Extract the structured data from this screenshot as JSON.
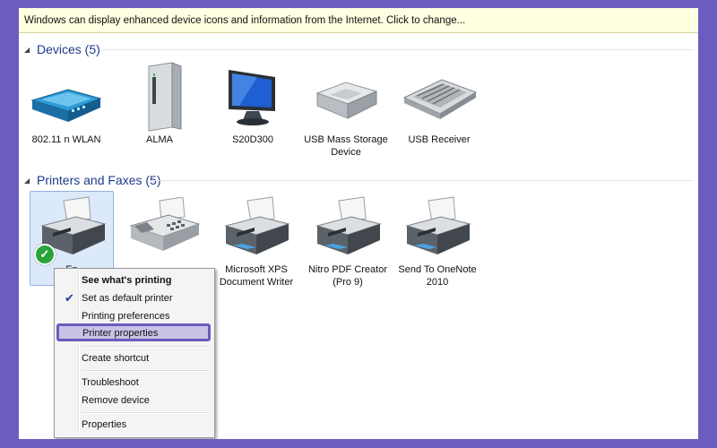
{
  "infobar": {
    "text": "Windows can display enhanced device icons and information from the Internet. Click to change..."
  },
  "devices_group": {
    "title": "Devices (5)"
  },
  "devices": [
    {
      "label": "802.11 n WLAN",
      "icon": "router-icon"
    },
    {
      "label": "ALMA",
      "icon": "computer-tower-icon"
    },
    {
      "label": "S20D300",
      "icon": "monitor-icon"
    },
    {
      "label": "USB Mass Storage Device",
      "icon": "hard-drive-icon"
    },
    {
      "label": "USB Receiver",
      "icon": "keyboard-icon"
    }
  ],
  "printers_group": {
    "title": "Printers and Faxes (5)"
  },
  "printers": [
    {
      "label": "Ep",
      "icon": "printer-icon",
      "default": true
    },
    {
      "label": "",
      "icon": "fax-icon"
    },
    {
      "label": "Microsoft XPS Document Writer",
      "icon": "printer-icon"
    },
    {
      "label": "Nitro PDF Creator (Pro 9)",
      "icon": "printer-icon"
    },
    {
      "label": "Send To OneNote 2010",
      "icon": "printer-icon"
    }
  ],
  "context_menu": {
    "items": {
      "see_printing": "See what's printing",
      "set_default": "Set as default printer",
      "preferences": "Printing preferences",
      "properties_printer": "Printer properties",
      "shortcut": "Create shortcut",
      "troubleshoot": "Troubleshoot",
      "remove": "Remove device",
      "properties": "Properties"
    },
    "checked_icon": "checkmark-icon",
    "highlighted": "Printer properties"
  },
  "colors": {
    "frame": "#6b5cc0",
    "highlight": "#6a5bbd",
    "header_text": "#1e3a8a",
    "infobar_bg": "#ffffe1"
  }
}
